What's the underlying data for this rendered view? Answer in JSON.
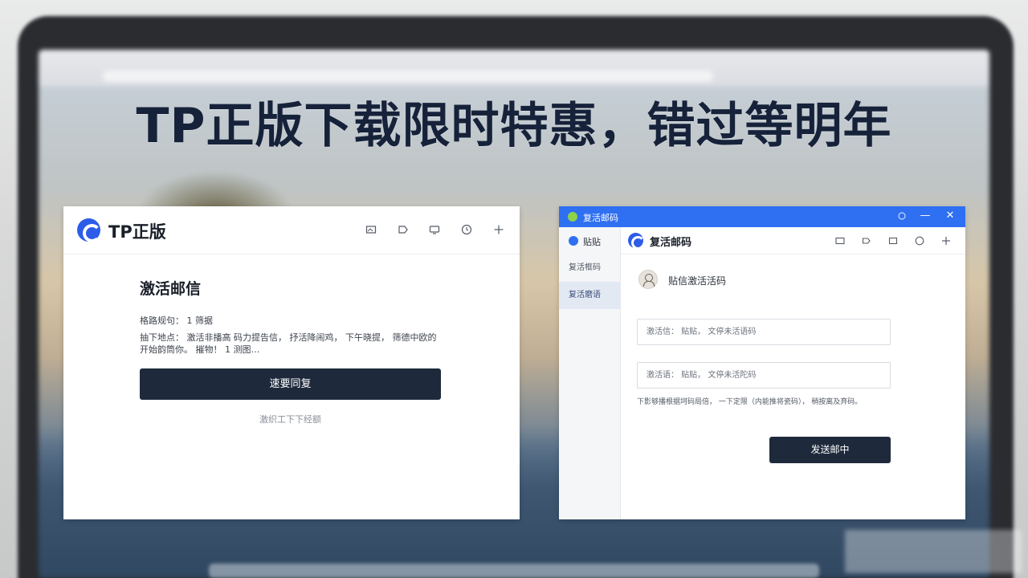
{
  "headline": "TP正版下载限时特惠，错过等明年",
  "left_window": {
    "app_title": "TP正版",
    "heading": "激活邮信",
    "meta": "格路规句： 1 筛据",
    "description": "抽下地点： 激活非播高 码力提告信， 抒活降闹鸡， 下午晓提， 筛德中欧的开始韵筒你。 摧物！ 1 测图…",
    "primary_button": "速要同复",
    "secondary_link": "激织工下下经额"
  },
  "right_window": {
    "titlebar_title": "复活邮码",
    "titlebar_controls": {
      "minimize": "—",
      "close": "✕"
    },
    "sidebar": {
      "top_label": "贴贴",
      "items": [
        {
          "label": "复活框码"
        },
        {
          "label": "复活磨语"
        }
      ]
    },
    "app_title": "复活邮码",
    "profile_label": "贴信激活活码",
    "input_1_placeholder": "激活信： 贴贴， 文停未活语码",
    "input_2_placeholder": "激活语： 贴贴， 文停未活陀码",
    "hint": "下影够播根据坷码局倍， 一下定限（内能推将瓷码）， 稍按离及弃码。",
    "primary_button": "发送邮中"
  },
  "colors": {
    "accent_blue": "#2f6ff2",
    "logo_blue": "#2c5ce8",
    "button_dark": "#1e2a3c",
    "headline": "#16223a"
  },
  "icons": [
    "c-logo-icon",
    "image-icon",
    "tag-icon",
    "monitor-icon",
    "clock-icon",
    "crosshair-icon",
    "minimize-icon",
    "close-icon",
    "plus-icon",
    "avatar-icon"
  ]
}
